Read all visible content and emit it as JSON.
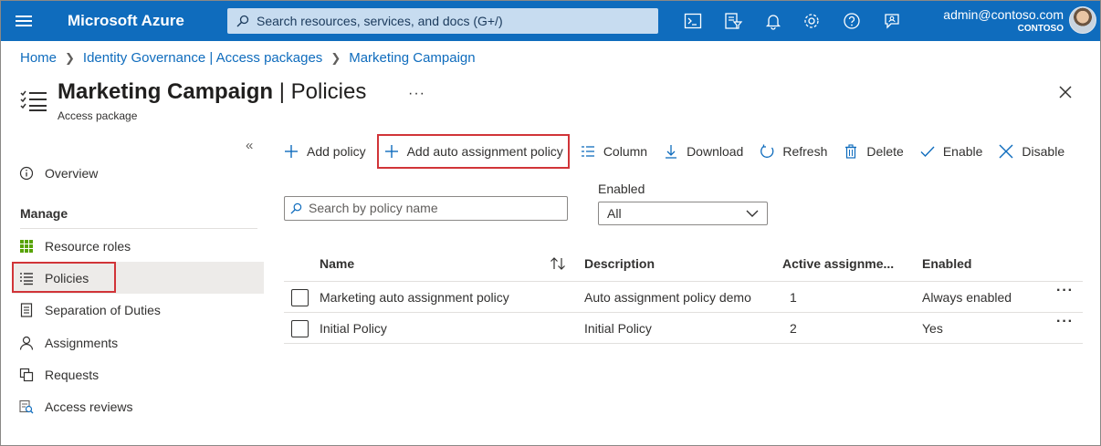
{
  "topbar": {
    "brand": "Microsoft Azure",
    "search_placeholder": "Search resources, services, and docs (G+/)",
    "user_email": "admin@contoso.com",
    "user_org": "CONTOSO",
    "icons": [
      "cloud-shell-icon",
      "directory-filter-icon",
      "notifications-icon",
      "settings-icon",
      "help-icon",
      "feedback-icon"
    ]
  },
  "breadcrumb": [
    "Home",
    "Identity Governance | Access packages",
    "Marketing Campaign"
  ],
  "page": {
    "title_main": "Marketing Campaign",
    "title_sep": " | ",
    "title_section": "Policies",
    "subtitle": "Access package",
    "more": "···"
  },
  "sidebar": {
    "collapse": "«",
    "overview": "Overview",
    "manage_label": "Manage",
    "items": [
      {
        "label": "Resource roles",
        "icon": "grid-icon"
      },
      {
        "label": "Policies",
        "icon": "list-icon",
        "active": true
      },
      {
        "label": "Separation of Duties",
        "icon": "document-icon"
      },
      {
        "label": "Assignments",
        "icon": "person-icon"
      },
      {
        "label": "Requests",
        "icon": "requests-icon"
      },
      {
        "label": "Access reviews",
        "icon": "review-icon"
      }
    ]
  },
  "toolbar": {
    "add_policy": "Add policy",
    "add_auto": "Add auto assignment policy",
    "column": "Column",
    "download": "Download",
    "refresh": "Refresh",
    "delete": "Delete",
    "enable": "Enable",
    "disable": "Disable"
  },
  "filters": {
    "search_placeholder": "Search by policy name",
    "enabled_label": "Enabled",
    "enabled_value": "All"
  },
  "table": {
    "headers": [
      "Name",
      "Description",
      "Active assignme...",
      "Enabled"
    ],
    "rows": [
      {
        "name": "Marketing auto assignment policy",
        "description": "Auto assignment policy demo",
        "active": "1",
        "enabled": "Always enabled"
      },
      {
        "name": "Initial Policy",
        "description": "Initial Policy",
        "active": "2",
        "enabled": "Yes"
      }
    ],
    "row_more": "···"
  },
  "colors": {
    "topbar": "#0f6cbd",
    "link": "#0f6cbd",
    "highlight": "#d13438",
    "active_nav": "#edebe9"
  }
}
